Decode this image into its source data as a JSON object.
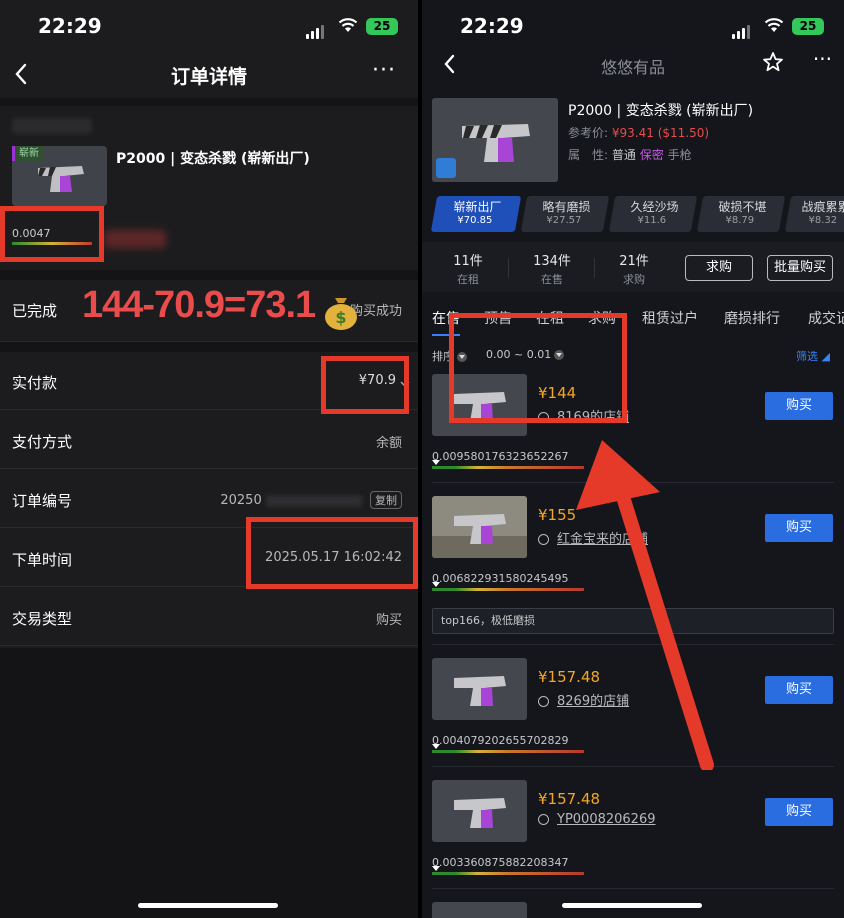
{
  "status": {
    "time": "22:29",
    "battery": "25"
  },
  "left": {
    "nav": {
      "title": "订单详情",
      "more": "···"
    },
    "item": {
      "tag": "崭新",
      "title": "P2000 | 变态杀戮 (崭新出厂)",
      "wear": "0.0047"
    },
    "state": {
      "label": "已完成",
      "result": "购买成功"
    },
    "overlay_text": "144-70.9=73.1",
    "rows": [
      {
        "key": "实付款",
        "value": "¥70.9"
      },
      {
        "key": "支付方式",
        "value": "余额"
      },
      {
        "key": "订单编号",
        "value": "20250",
        "action": "复制"
      },
      {
        "key": "下单时间",
        "value": "2025.05.17 16:02:42"
      },
      {
        "key": "交易类型",
        "value": "购买"
      }
    ]
  },
  "right": {
    "nav": {
      "title": "悠悠有品",
      "more": "···"
    },
    "item": {
      "title": "P2000 | 变态杀戮 (崭新出厂)",
      "ref_label": "参考价:",
      "ref_price": "¥93.41",
      "ref_usd": "($11.50)",
      "attr_label": "属　性:",
      "attr_quality": "普通",
      "attr_rarity": "保密",
      "attr_type": "手枪"
    },
    "wear_tabs": [
      {
        "name": "崭新出厂",
        "price": "¥70.85",
        "selected": true
      },
      {
        "name": "略有磨损",
        "price": "¥27.57",
        "selected": false
      },
      {
        "name": "久经沙场",
        "price": "¥11.6",
        "selected": false
      },
      {
        "name": "破损不堪",
        "price": "¥8.79",
        "selected": false
      },
      {
        "name": "战痕累累",
        "price": "¥8.32",
        "selected": false
      }
    ],
    "stats": [
      {
        "count": "11件",
        "label": "在租"
      },
      {
        "count": "134件",
        "label": "在售"
      },
      {
        "count": "21件",
        "label": "求购"
      }
    ],
    "buttons": {
      "want": "求购",
      "batch": "批量购买"
    },
    "tabs": [
      "在售",
      "预售",
      "在租",
      "求购",
      "租赁过户",
      "磨损排行",
      "成交记录"
    ],
    "filter": {
      "sort": "排序",
      "range": "0.00 ~ 0.01",
      "filter": "筛选"
    },
    "listings": [
      {
        "price": "¥144",
        "shop": "8169的店铺",
        "wear": "0.009580176323652267",
        "buy": "购买"
      },
      {
        "price": "¥155",
        "shop": "红金宝来的店铺",
        "wear": "0.006822931580245495",
        "buy": "购买"
      },
      {
        "price": "¥157.48",
        "shop": "8269的店铺",
        "wear": "0.004079202655702829",
        "buy": "购买"
      },
      {
        "price": "¥157.48",
        "shop": "YP0008206269",
        "wear": "0.003360875882208347",
        "buy": "购买"
      }
    ],
    "note": "top166，极低磨损"
  },
  "colors": {
    "accent": "#2a6de0",
    "highlight": "#e53a2a",
    "price": "#f5a623",
    "rare": "#c659e6"
  }
}
